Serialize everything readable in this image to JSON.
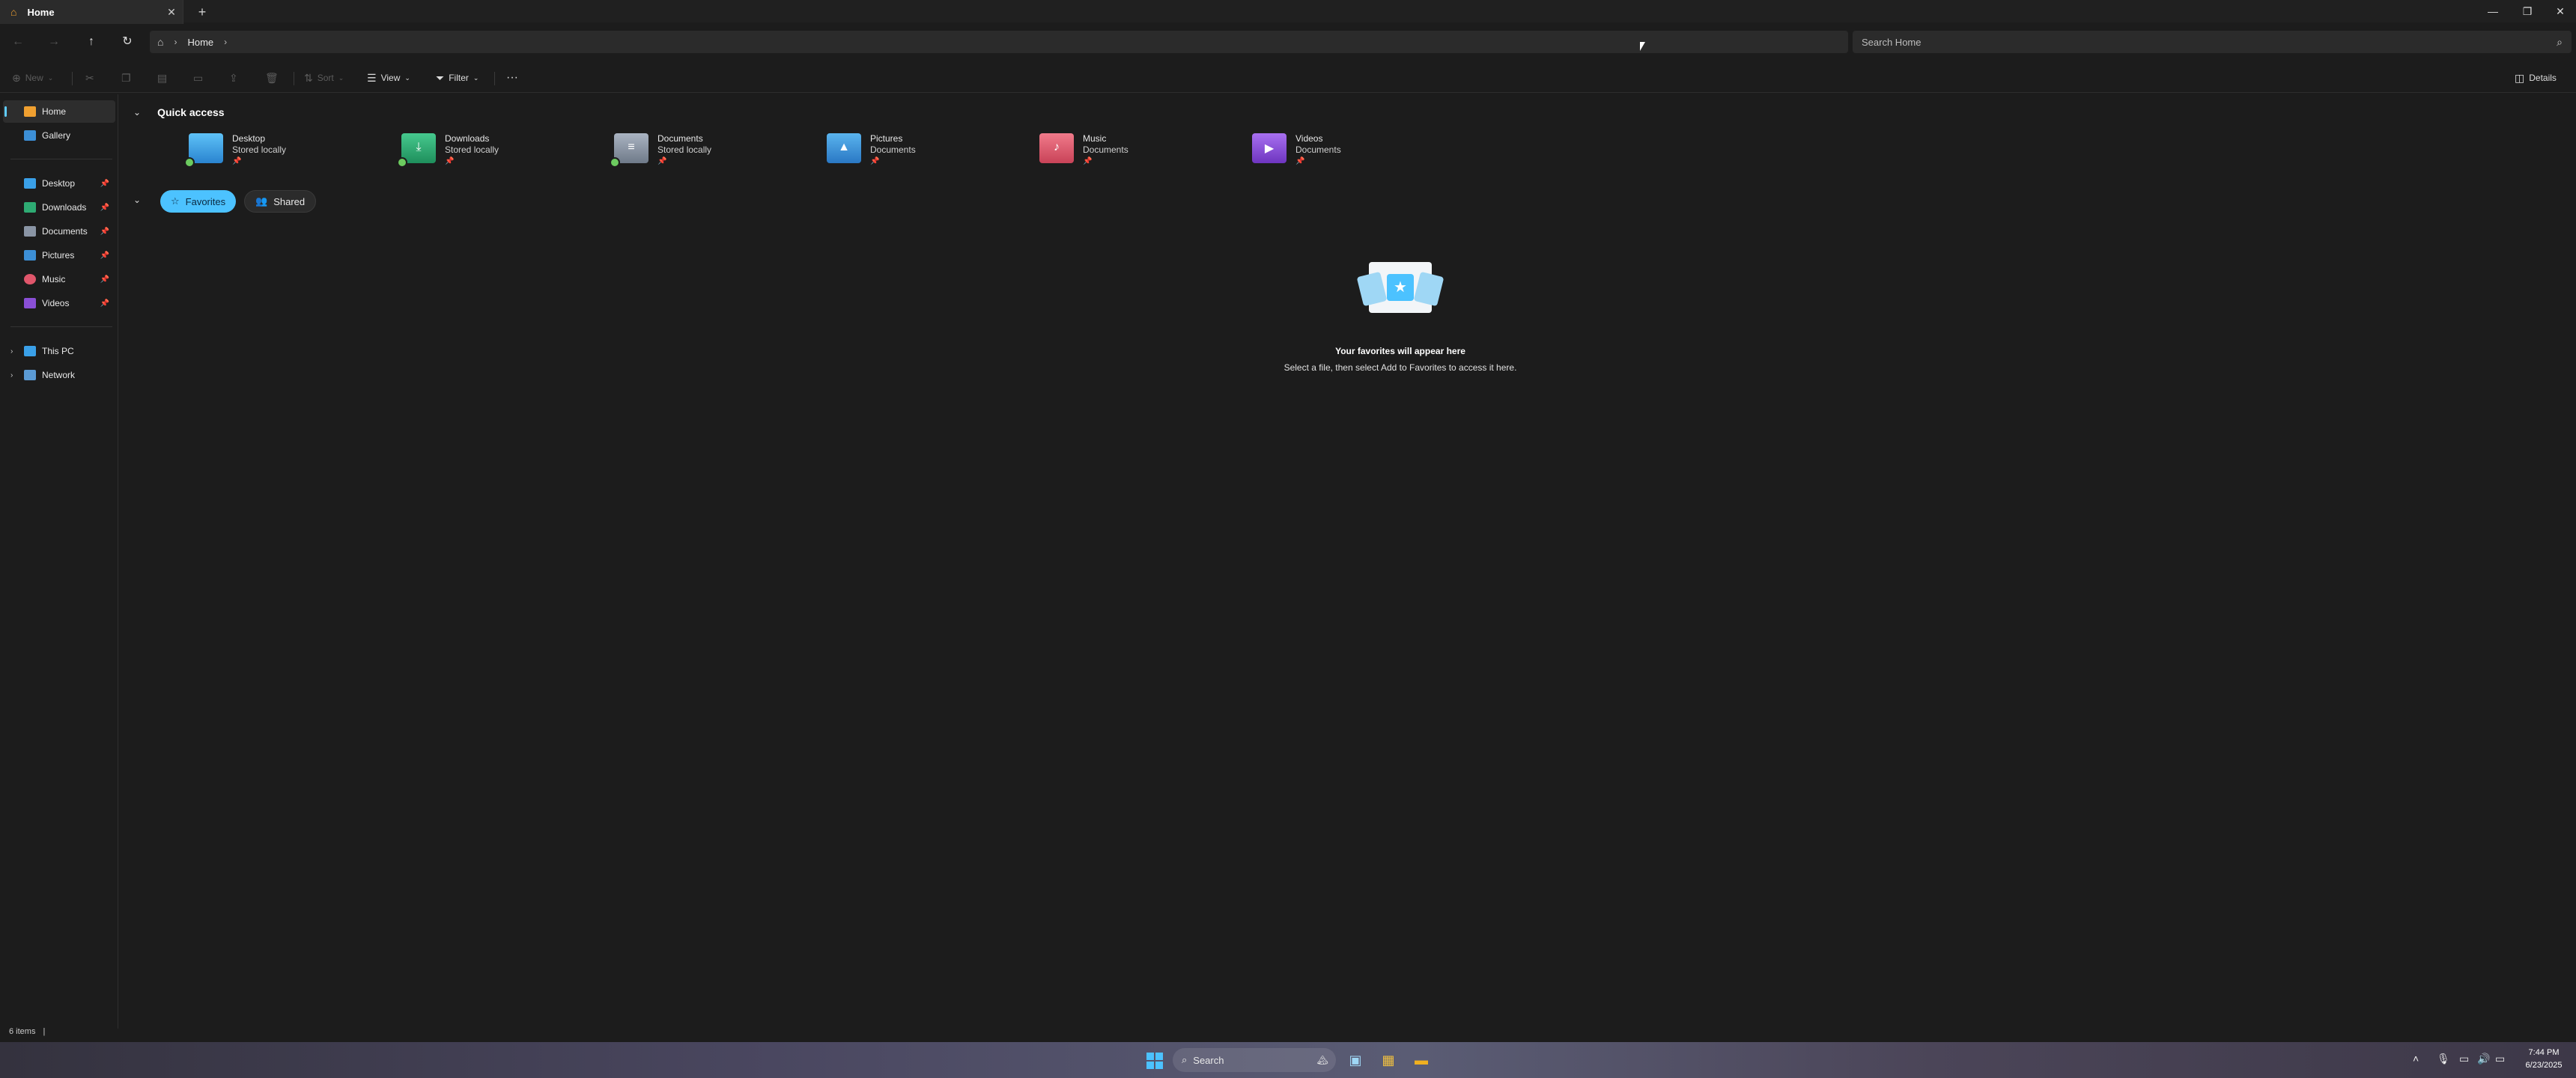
{
  "window": {
    "tab_title": "Home",
    "new_tab_icon": "plus-icon",
    "close_tab_icon": "close-icon"
  },
  "address": {
    "crumbs": [
      "Home"
    ],
    "search_placeholder": "Search Home"
  },
  "command_bar": {
    "new_label": "New",
    "sort_label": "Sort",
    "view_label": "View",
    "filter_label": "Filter",
    "details_label": "Details"
  },
  "sidebar": {
    "top_items": [
      "Home",
      "Gallery"
    ],
    "pinned_items": [
      "Desktop",
      "Downloads",
      "Documents",
      "Pictures",
      "Music",
      "Videos"
    ],
    "tree_items": [
      "This PC",
      "Network"
    ]
  },
  "main": {
    "quick_access_title": "Quick access",
    "quick_access": [
      {
        "name": "Desktop",
        "location": "Stored locally",
        "color": "#3aa0e8"
      },
      {
        "name": "Downloads",
        "location": "Stored locally",
        "color": "#2eab73"
      },
      {
        "name": "Documents",
        "location": "Stored locally",
        "color": "#8a95a5"
      },
      {
        "name": "Pictures",
        "location": "Documents",
        "color": "#3c8fd6"
      },
      {
        "name": "Music",
        "location": "Documents",
        "color": "#e0566b"
      },
      {
        "name": "Videos",
        "location": "Documents",
        "color": "#8a4fd6"
      }
    ],
    "tabs": [
      "Favorites",
      "Shared"
    ],
    "empty_title": "Your favorites will appear here",
    "empty_subtitle": "Select a file, then select Add to Favorites to access it here."
  },
  "status": {
    "item_count": "6 items"
  },
  "taskbar": {
    "search_label": "Search",
    "time": "7:44 PM",
    "date": "6/23/2025"
  },
  "colors": {
    "accent": "#4cc2ff",
    "background": "#1c1c1c"
  }
}
